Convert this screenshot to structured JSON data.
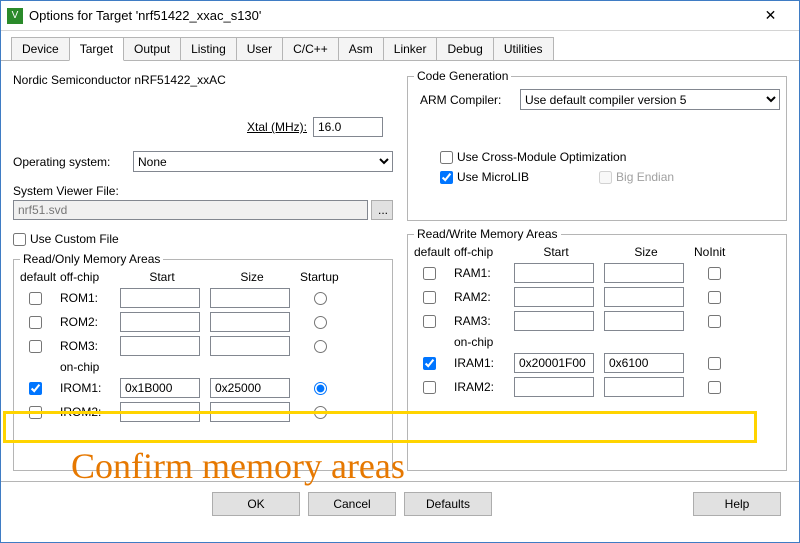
{
  "window": {
    "title": "Options for Target 'nrf51422_xxac_s130'"
  },
  "tabs": [
    "Device",
    "Target",
    "Output",
    "Listing",
    "User",
    "C/C++",
    "Asm",
    "Linker",
    "Debug",
    "Utilities"
  ],
  "active_tab": 1,
  "device_line": "Nordic Semiconductor nRF51422_xxAC",
  "xtal": {
    "label": "Xtal (MHz):",
    "value": "16.0"
  },
  "os": {
    "label": "Operating system:",
    "value": "None"
  },
  "svf": {
    "label": "System Viewer File:",
    "value": "nrf51.svd"
  },
  "use_custom_file": {
    "label": "Use Custom File",
    "checked": false
  },
  "codegen": {
    "legend": "Code Generation",
    "compiler_label": "ARM Compiler:",
    "compiler_value": "Use default compiler version 5",
    "cross_module": {
      "label": "Use Cross-Module Optimization",
      "checked": false
    },
    "microlib": {
      "label": "Use MicroLIB",
      "checked": true
    },
    "big_endian": {
      "label": "Big Endian",
      "checked": false
    }
  },
  "rom": {
    "legend": "Read/Only Memory Areas",
    "headers": {
      "default": "default",
      "offchip": "off-chip",
      "onchip": "on-chip",
      "start": "Start",
      "size": "Size",
      "startup": "Startup"
    },
    "rows": [
      {
        "label": "ROM1:",
        "default": false,
        "start": "",
        "size": "",
        "startup": false
      },
      {
        "label": "ROM2:",
        "default": false,
        "start": "",
        "size": "",
        "startup": false
      },
      {
        "label": "ROM3:",
        "default": false,
        "start": "",
        "size": "",
        "startup": false
      },
      {
        "label": "IROM1:",
        "default": true,
        "start": "0x1B000",
        "size": "0x25000",
        "startup": true
      },
      {
        "label": "IROM2:",
        "default": false,
        "start": "",
        "size": "",
        "startup": false
      }
    ]
  },
  "ram": {
    "legend": "Read/Write Memory Areas",
    "headers": {
      "default": "default",
      "offchip": "off-chip",
      "onchip": "on-chip",
      "start": "Start",
      "size": "Size",
      "noinit": "NoInit"
    },
    "rows": [
      {
        "label": "RAM1:",
        "default": false,
        "start": "",
        "size": "",
        "noinit": false
      },
      {
        "label": "RAM2:",
        "default": false,
        "start": "",
        "size": "",
        "noinit": false
      },
      {
        "label": "RAM3:",
        "default": false,
        "start": "",
        "size": "",
        "noinit": false
      },
      {
        "label": "IRAM1:",
        "default": true,
        "start": "0x20001F00",
        "size": "0x6100",
        "noinit": false
      },
      {
        "label": "IRAM2:",
        "default": false,
        "start": "",
        "size": "",
        "noinit": false
      }
    ]
  },
  "buttons": {
    "ok": "OK",
    "cancel": "Cancel",
    "defaults": "Defaults",
    "help": "Help"
  },
  "annotation": "Confirm memory areas"
}
